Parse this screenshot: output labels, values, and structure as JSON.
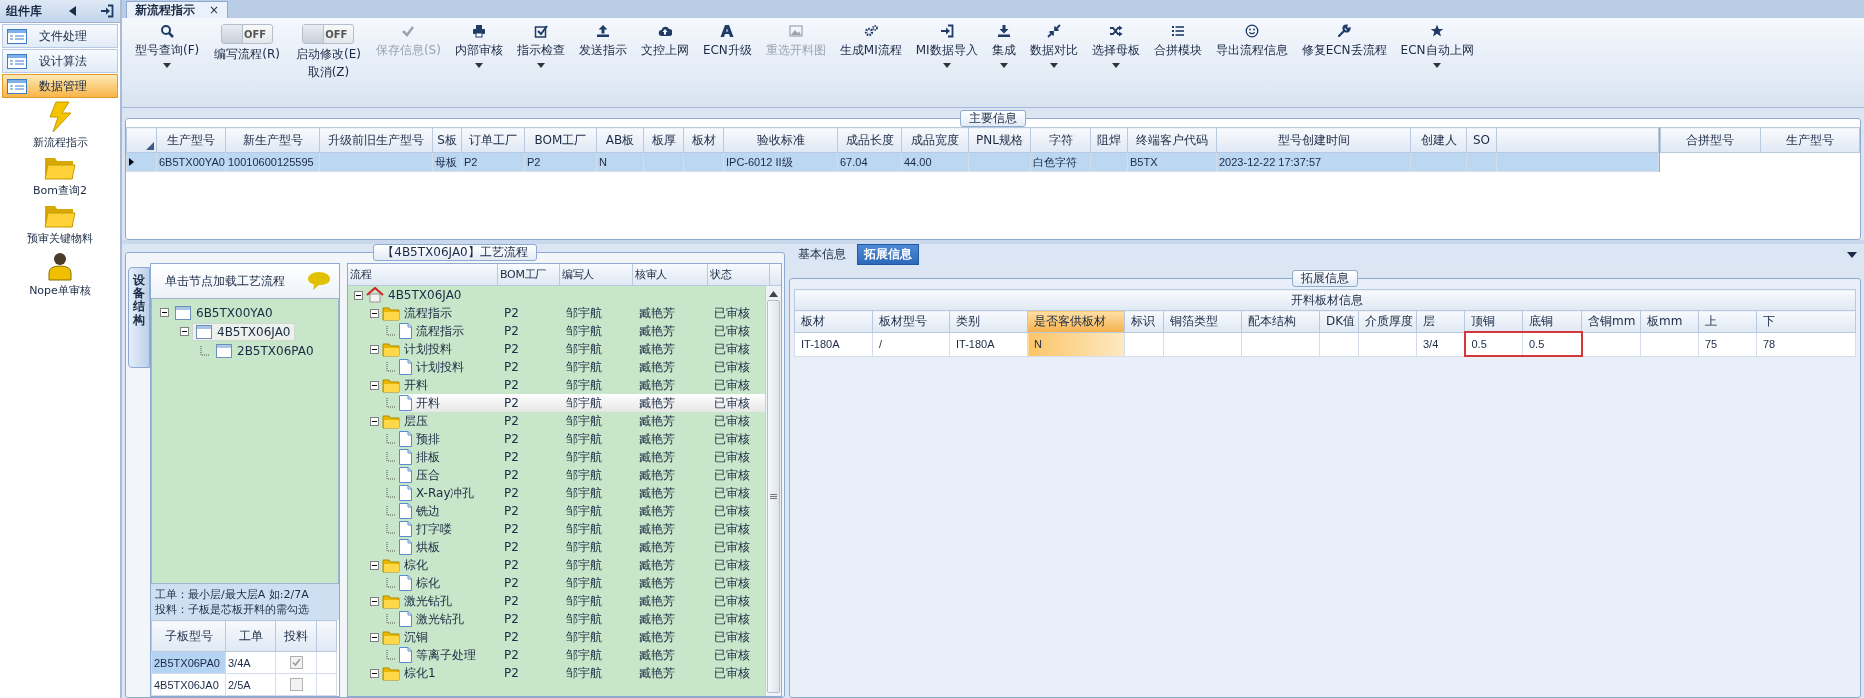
{
  "sidebar": {
    "title": "组件库",
    "menu": [
      {
        "label": "文件处理",
        "selected": false
      },
      {
        "label": "设计算法",
        "selected": false
      },
      {
        "label": "数据管理",
        "selected": true
      }
    ],
    "tools": [
      {
        "label": "新流程指示"
      },
      {
        "label": "Bom查询2"
      },
      {
        "label": "预审关键物料"
      },
      {
        "label": "Nope单审核"
      }
    ]
  },
  "document_tab": {
    "title": "新流程指示",
    "close": "×"
  },
  "toolbar": [
    {
      "kind": "button",
      "lines": [
        "型号查询(F)"
      ],
      "caret": true,
      "disabled": false
    },
    {
      "kind": "toggle",
      "switch_text": "OFF",
      "on": false,
      "lines": [
        "编写流程(R)"
      ]
    },
    {
      "kind": "toggle",
      "switch_text": "OFF",
      "on": false,
      "lines": [
        "启动修改(E)",
        "取消(Z)"
      ]
    },
    {
      "kind": "button",
      "lines": [
        "保存信息(S)"
      ],
      "caret": false,
      "disabled": true
    },
    {
      "kind": "button",
      "lines": [
        "内部审核"
      ],
      "caret": true,
      "disabled": false
    },
    {
      "kind": "button",
      "lines": [
        "指示检查"
      ],
      "caret": true,
      "disabled": false
    },
    {
      "kind": "button",
      "lines": [
        "发送指示"
      ],
      "caret": false,
      "disabled": false
    },
    {
      "kind": "button",
      "lines": [
        "文控上网"
      ],
      "caret": false,
      "disabled": false
    },
    {
      "kind": "button",
      "lines": [
        "ECN升级"
      ],
      "caret": false,
      "disabled": false
    },
    {
      "kind": "button",
      "lines": [
        "重选开料图"
      ],
      "caret": false,
      "disabled": true
    },
    {
      "kind": "button",
      "lines": [
        "生成MI流程"
      ],
      "caret": false,
      "disabled": false
    },
    {
      "kind": "button",
      "lines": [
        "MI数据导入"
      ],
      "caret": true,
      "disabled": false
    },
    {
      "kind": "button",
      "lines": [
        "集成"
      ],
      "caret": true,
      "disabled": false
    },
    {
      "kind": "button",
      "lines": [
        "数据对比"
      ],
      "caret": true,
      "disabled": false
    },
    {
      "kind": "button",
      "lines": [
        "选择母板"
      ],
      "caret": true,
      "disabled": false
    },
    {
      "kind": "button",
      "lines": [
        "合拼模块"
      ],
      "caret": false,
      "disabled": false
    },
    {
      "kind": "button",
      "lines": [
        "导出流程信息"
      ],
      "caret": false,
      "disabled": false
    },
    {
      "kind": "button",
      "lines": [
        "修复ECN丢流程"
      ],
      "caret": false,
      "disabled": false
    },
    {
      "kind": "button",
      "lines": [
        "ECN自动上网"
      ],
      "caret": true,
      "disabled": false
    }
  ],
  "main_info": {
    "title": "主要信息",
    "columns": [
      "生产型号",
      "新生产型号",
      "升级前旧生产型号",
      "S板",
      "订单工厂",
      "BOM工厂",
      "AB板",
      "板厚",
      "板材",
      "验收标准",
      "成品长度",
      "成品宽度",
      "PNL规格",
      "字符",
      "阻焊",
      "终端客户代码",
      "型号创建时间",
      "创建人",
      "SO"
    ],
    "rows": [
      {
        "selected": true,
        "cells": [
          "6B5TX00YA0",
          "10010600125595",
          null,
          "母板",
          "P2",
          "P2",
          "N",
          null,
          null,
          "IPC-6012 II级",
          "67.04",
          "44.00",
          null,
          "白色字符",
          null,
          "B5TX",
          "2023-12-22 17:37:57",
          null,
          null
        ]
      }
    ],
    "side_columns": [
      "合拼型号",
      "生产型号"
    ]
  },
  "process_panel": {
    "title": "【4B5TX06JA0】工艺流程",
    "side_tab": "设备结构",
    "device_tree": {
      "header": "单击节点加载工艺流程",
      "nodes": [
        {
          "label": "6B5TX00YA0",
          "selected": false,
          "expanded": true,
          "children": [
            {
              "label": "4B5TX06JA0",
              "selected": true,
              "expanded": true,
              "children": [
                {
                  "label": "2B5TX06PA0",
                  "selected": false
                }
              ]
            }
          ]
        }
      ]
    },
    "notes": [
      "工单：最小层/最大层A 如:2/7A",
      "投料：子板是芯板开料的需勾选"
    ],
    "sub_boards": {
      "columns": [
        "子板型号",
        "工单",
        "投料"
      ],
      "rows": [
        {
          "model": "2B5TX06PA0",
          "order": "3/4A",
          "checked": true,
          "selected": true
        },
        {
          "model": "4B5TX06JA0",
          "order": "2/5A",
          "checked": false,
          "selected": false
        }
      ]
    },
    "flow": {
      "columns": [
        "流程",
        "BOM工厂",
        "编写人",
        "核审人",
        "状态"
      ],
      "nodes": [
        {
          "label": "4B5TX06JA0",
          "expanded": true,
          "selected": false,
          "children": [
            {
              "label": "流程指示",
              "expanded": true,
              "selected": false,
              "bom": "P2",
              "writer": "邹宇航",
              "reviewer": "臧艳芳",
              "status": "已审核",
              "children": [
                {
                  "label": "流程指示",
                  "selected": false,
                  "bom": "P2",
                  "writer": "邹宇航",
                  "reviewer": "臧艳芳",
                  "status": "已审核"
                }
              ]
            },
            {
              "label": "计划投料",
              "expanded": true,
              "selected": false,
              "bom": "P2",
              "writer": "邹宇航",
              "reviewer": "臧艳芳",
              "status": "已审核",
              "children": [
                {
                  "label": "计划投料",
                  "selected": false,
                  "bom": "P2",
                  "writer": "邹宇航",
                  "reviewer": "臧艳芳",
                  "status": "已审核"
                }
              ]
            },
            {
              "label": "开料",
              "expanded": true,
              "selected": false,
              "bom": "P2",
              "writer": "邹宇航",
              "reviewer": "臧艳芳",
              "status": "已审核",
              "children": [
                {
                  "label": "开料",
                  "selected": true,
                  "bom": "P2",
                  "writer": "邹宇航",
                  "reviewer": "臧艳芳",
                  "status": "已审核"
                }
              ]
            },
            {
              "label": "层压",
              "expanded": true,
              "selected": false,
              "bom": "P2",
              "writer": "邹宇航",
              "reviewer": "臧艳芳",
              "status": "已审核",
              "children": [
                {
                  "label": "预排",
                  "selected": false,
                  "bom": "P2",
                  "writer": "邹宇航",
                  "reviewer": "臧艳芳",
                  "status": "已审核"
                },
                {
                  "label": "排板",
                  "selected": false,
                  "bom": "P2",
                  "writer": "邹宇航",
                  "reviewer": "臧艳芳",
                  "status": "已审核"
                },
                {
                  "label": "压合",
                  "selected": false,
                  "bom": "P2",
                  "writer": "邹宇航",
                  "reviewer": "臧艳芳",
                  "status": "已审核"
                },
                {
                  "label": "X-Ray冲孔",
                  "selected": false,
                  "bom": "P2",
                  "writer": "邹宇航",
                  "reviewer": "臧艳芳",
                  "status": "已审核"
                },
                {
                  "label": "铣边",
                  "selected": false,
                  "bom": "P2",
                  "writer": "邹宇航",
                  "reviewer": "臧艳芳",
                  "status": "已审核"
                },
                {
                  "label": "打字喽",
                  "selected": false,
                  "bom": "P2",
                  "writer": "邹宇航",
                  "reviewer": "臧艳芳",
                  "status": "已审核"
                },
                {
                  "label": "烘板",
                  "selected": false,
                  "bom": "P2",
                  "writer": "邹宇航",
                  "reviewer": "臧艳芳",
                  "status": "已审核"
                }
              ]
            },
            {
              "label": "棕化",
              "expanded": true,
              "selected": false,
              "bom": "P2",
              "writer": "邹宇航",
              "reviewer": "臧艳芳",
              "status": "已审核",
              "children": [
                {
                  "label": "棕化",
                  "selected": false,
                  "bom": "P2",
                  "writer": "邹宇航",
                  "reviewer": "臧艳芳",
                  "status": "已审核"
                }
              ]
            },
            {
              "label": "激光钻孔",
              "expanded": true,
              "selected": false,
              "bom": "P2",
              "writer": "邹宇航",
              "reviewer": "臧艳芳",
              "status": "已审核",
              "children": [
                {
                  "label": "激光钻孔",
                  "selected": false,
                  "bom": "P2",
                  "writer": "邹宇航",
                  "reviewer": "臧艳芳",
                  "status": "已审核"
                }
              ]
            },
            {
              "label": "沉铜",
              "expanded": true,
              "selected": false,
              "bom": "P2",
              "writer": "邹宇航",
              "reviewer": "臧艳芳",
              "status": "已审核",
              "children": [
                {
                  "label": "等离子处理",
                  "selected": false,
                  "bom": "P2",
                  "writer": "邹宇航",
                  "reviewer": "臧艳芳",
                  "status": "已审核"
                }
              ]
            },
            {
              "label": "棕化1",
              "expanded": true,
              "selected": false,
              "bom": "P2",
              "writer": "邹宇航",
              "reviewer": "臧艳芳",
              "status": "已审核"
            }
          ]
        }
      ]
    }
  },
  "detail_panel": {
    "tabs": [
      {
        "label": "基本信息",
        "selected": false
      },
      {
        "label": "拓展信息",
        "selected": true
      }
    ],
    "title": "拓展信息",
    "table": {
      "title": "开料板材信息",
      "columns": [
        {
          "label": "板材",
          "focused": false
        },
        {
          "label": "板材型号",
          "focused": false
        },
        {
          "label": "类别",
          "focused": false
        },
        {
          "label": "是否客供板材",
          "focused": true
        },
        {
          "label": "标识",
          "focused": false
        },
        {
          "label": "铜箔类型",
          "focused": false
        },
        {
          "label": "配本结构",
          "focused": false
        },
        {
          "label": "DK值",
          "focused": false
        },
        {
          "label": "介质厚度",
          "focused": false
        },
        {
          "label": "层",
          "focused": false
        },
        {
          "label": "顶铜",
          "focused": false
        },
        {
          "label": "底铜",
          "focused": false
        },
        {
          "label": "含铜mm",
          "focused": false
        },
        {
          "label": "板mm",
          "focused": false
        },
        {
          "label": "上",
          "focused": false
        },
        {
          "label": "下",
          "focused": false
        }
      ],
      "rows": [
        {
          "cells": [
            {
              "text": "IT-180A",
              "ringed": false
            },
            {
              "text": "/",
              "ringed": false
            },
            {
              "text": "IT-180A",
              "ringed": false
            },
            {
              "text": "N",
              "ringed": false
            },
            {
              "ringed": false
            },
            {
              "ringed": false
            },
            {
              "ringed": false
            },
            {
              "ringed": false
            },
            {
              "ringed": false
            },
            {
              "text": "3/4",
              "ringed": false
            },
            {
              "text": "0.5",
              "ringed": true
            },
            {
              "text": "0.5",
              "ringed": true
            },
            {
              "ringed": false
            },
            {
              "ringed": false
            },
            {
              "text": "75",
              "ringed": false
            },
            {
              "text": "78",
              "ringed": false
            }
          ]
        }
      ]
    }
  }
}
